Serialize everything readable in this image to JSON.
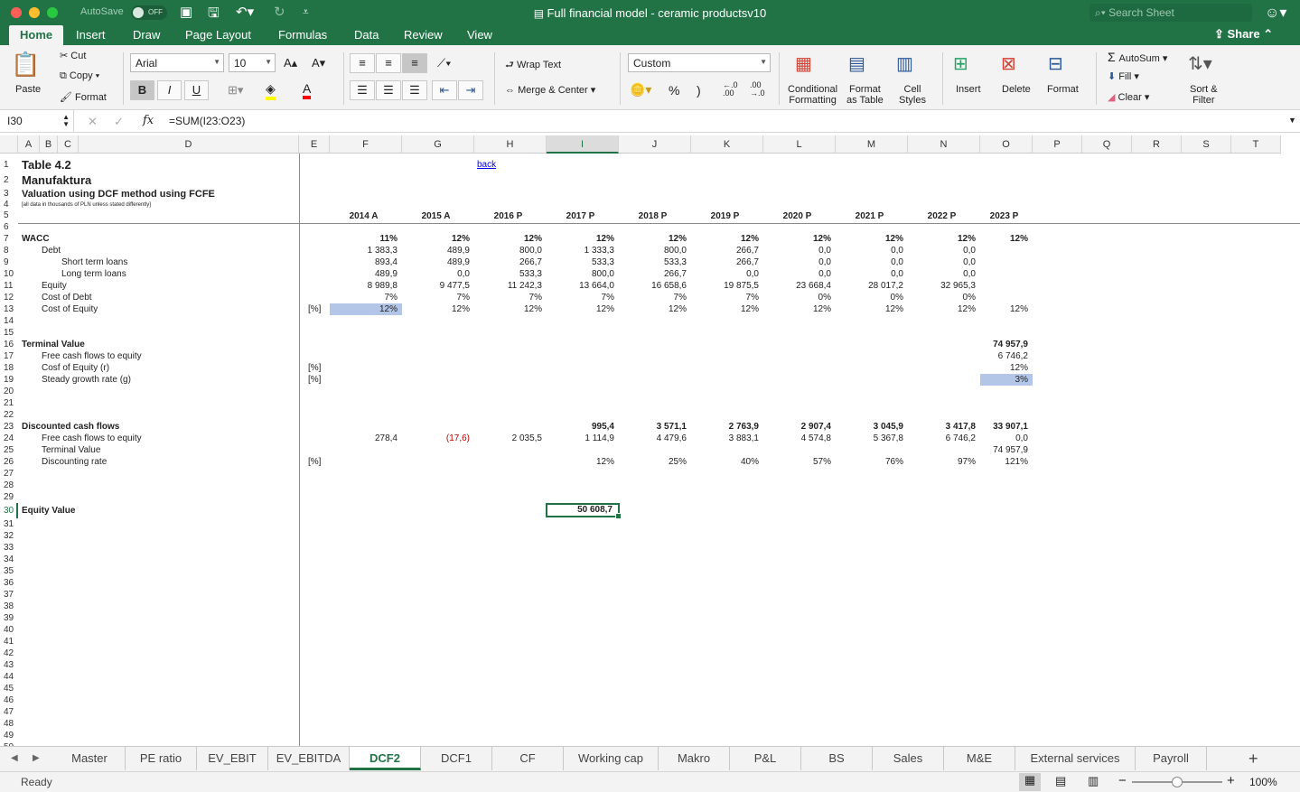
{
  "window": {
    "title": "Full financial model - ceramic productsv10",
    "autosave_label": "AutoSave",
    "autosave_state": "OFF",
    "search_placeholder": "Search Sheet"
  },
  "ribbon_tabs": [
    "Home",
    "Insert",
    "Draw",
    "Page Layout",
    "Formulas",
    "Data",
    "Review",
    "View"
  ],
  "share_label": "Share",
  "ribbon": {
    "paste": "Paste",
    "cut": "Cut",
    "copy": "Copy",
    "format_painter": "Format",
    "font_name": "Arial",
    "font_size": "10",
    "bold": "B",
    "italic": "I",
    "underline": "U",
    "wrap_text": "Wrap Text",
    "merge_center": "Merge & Center",
    "number_format": "Custom",
    "percent": "%",
    "comma": ")",
    "conditional_formatting": [
      "Conditional",
      "Formatting"
    ],
    "format_as_table": [
      "Format",
      "as Table"
    ],
    "cell_styles": [
      "Cell",
      "Styles"
    ],
    "insert": "Insert",
    "delete": "Delete",
    "format": "Format",
    "autosum": "AutoSum",
    "fill": "Fill",
    "clear": "Clear",
    "sort_filter": [
      "Sort &",
      "Filter"
    ]
  },
  "formula_bar": {
    "name_box": "I30",
    "formula": "=SUM(I23:O23)"
  },
  "columns": [
    "A",
    "B",
    "C",
    "D",
    "E",
    "F",
    "G",
    "H",
    "I",
    "J",
    "K",
    "L",
    "M",
    "N",
    "O",
    "P",
    "Q",
    "R",
    "S",
    "T"
  ],
  "selected_column": "I",
  "selected_row": 30,
  "sheet": {
    "title": "Table 4.2",
    "company": "Manufaktura",
    "subtitle": "Valuation using DCF method using FCFE",
    "note": "[all data in thousands of PLN unless stated differently]",
    "back_link": "back",
    "years": [
      "2014 A",
      "2015 A",
      "2016 P",
      "2017 P",
      "2018 P",
      "2019 P",
      "2020 P",
      "2021 P",
      "2022 P",
      "2023 P"
    ],
    "rows": [
      {
        "row": 7,
        "label": "WACC",
        "indent": 0,
        "bold": true,
        "unit": "",
        "values": [
          "11%",
          "12%",
          "12%",
          "12%",
          "12%",
          "12%",
          "12%",
          "12%",
          "12%",
          "12%"
        ],
        "bold_values": true
      },
      {
        "row": 8,
        "label": "Debt",
        "indent": 1,
        "unit": "",
        "values": [
          "1 383,3",
          "489,9",
          "800,0",
          "1 333,3",
          "800,0",
          "266,7",
          "0,0",
          "0,0",
          "0,0",
          ""
        ]
      },
      {
        "row": 9,
        "label": "Short term loans",
        "indent": 2,
        "unit": "",
        "values": [
          "893,4",
          "489,9",
          "266,7",
          "533,3",
          "533,3",
          "266,7",
          "0,0",
          "0,0",
          "0,0",
          ""
        ]
      },
      {
        "row": 10,
        "label": "Long term loans",
        "indent": 2,
        "unit": "",
        "values": [
          "489,9",
          "0,0",
          "533,3",
          "800,0",
          "266,7",
          "0,0",
          "0,0",
          "0,0",
          "0,0",
          ""
        ]
      },
      {
        "row": 11,
        "label": "Equity",
        "indent": 1,
        "unit": "",
        "values": [
          "8 989,8",
          "9 477,5",
          "11 242,3",
          "13 664,0",
          "16 658,6",
          "19 875,5",
          "23 668,4",
          "28 017,2",
          "32 965,3",
          ""
        ]
      },
      {
        "row": 12,
        "label": "Cost of Debt",
        "indent": 1,
        "unit": "",
        "values": [
          "7%",
          "7%",
          "7%",
          "7%",
          "7%",
          "7%",
          "0%",
          "0%",
          "0%",
          ""
        ]
      },
      {
        "row": 13,
        "label": "Cost of Equity",
        "indent": 1,
        "unit": "[%]",
        "values": [
          "12%",
          "12%",
          "12%",
          "12%",
          "12%",
          "12%",
          "12%",
          "12%",
          "12%",
          "12%"
        ],
        "hl_index": 0
      },
      {
        "row": 16,
        "label": "Terminal Value",
        "indent": 0,
        "bold": true,
        "unit": "",
        "values": [
          "",
          "",
          "",
          "",
          "",
          "",
          "",
          "",
          "",
          "74 957,9"
        ],
        "bold_values": true
      },
      {
        "row": 17,
        "label": "Free cash flows to equity",
        "indent": 1,
        "unit": "",
        "values": [
          "",
          "",
          "",
          "",
          "",
          "",
          "",
          "",
          "",
          "6 746,2"
        ]
      },
      {
        "row": 18,
        "label": "Cosf of Equity (r)",
        "indent": 1,
        "unit": "[%]",
        "values": [
          "",
          "",
          "",
          "",
          "",
          "",
          "",
          "",
          "",
          "12%"
        ]
      },
      {
        "row": 19,
        "label": "Steady growth rate (g)",
        "indent": 1,
        "unit": "[%]",
        "values": [
          "",
          "",
          "",
          "",
          "",
          "",
          "",
          "",
          "",
          "3%"
        ],
        "hl_index": 9
      },
      {
        "row": 23,
        "label": "Discounted cash flows",
        "indent": 0,
        "bold": true,
        "unit": "",
        "values": [
          "",
          "",
          "",
          "995,4",
          "3 571,1",
          "2 763,9",
          "2 907,4",
          "3 045,9",
          "3 417,8",
          "33 907,1"
        ],
        "bold_values": true
      },
      {
        "row": 24,
        "label": "Free cash flows to equity",
        "indent": 1,
        "unit": "",
        "values": [
          "278,4",
          "(17,6)",
          "2 035,5",
          "1 114,9",
          "4 479,6",
          "3 883,1",
          "4 574,8",
          "5 367,8",
          "6 746,2",
          "0,0"
        ],
        "red_index": 1
      },
      {
        "row": 25,
        "label": "Terminal Value",
        "indent": 1,
        "unit": "",
        "values": [
          "",
          "",
          "",
          "",
          "",
          "",
          "",
          "",
          "",
          "74 957,9"
        ]
      },
      {
        "row": 26,
        "label": "Discounting rate",
        "indent": 1,
        "unit": "[%]",
        "values": [
          "",
          "",
          "",
          "12%",
          "25%",
          "40%",
          "57%",
          "76%",
          "97%",
          "121%"
        ]
      }
    ],
    "equity_label": "Equity Value",
    "equity_value": "50 608,7"
  },
  "sheet_tabs": [
    "Master",
    "PE ratio",
    "EV_EBIT",
    "EV_EBITDA",
    "DCF2",
    "DCF1",
    "CF",
    "Working cap",
    "Makro",
    "P&L",
    "BS",
    "Sales",
    "M&E",
    "External services",
    "Payroll"
  ],
  "active_sheet": "DCF2",
  "status": {
    "text": "Ready",
    "zoom": "100%"
  }
}
